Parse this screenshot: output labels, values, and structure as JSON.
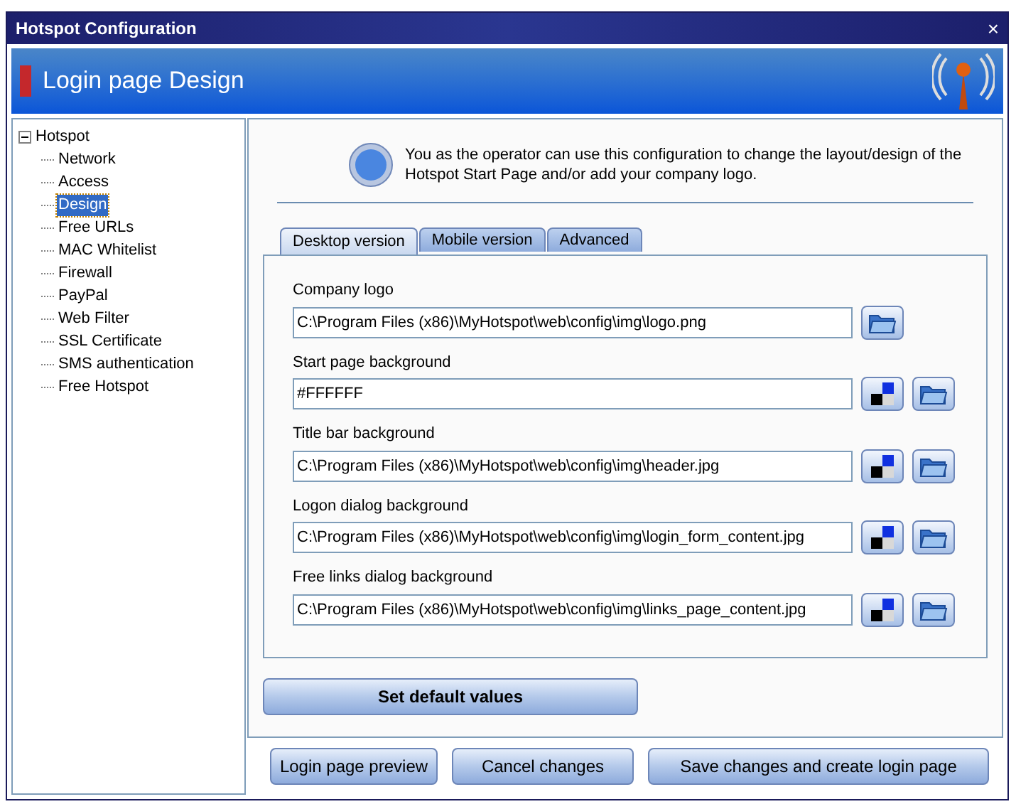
{
  "window": {
    "title": "Hotspot Configuration",
    "close": "×"
  },
  "header": {
    "title": "Login page Design"
  },
  "sidebar": {
    "tree": [
      {
        "label": "Hotspot",
        "expanded": true,
        "selected": false,
        "children": [
          {
            "label": "Network",
            "selected": false
          },
          {
            "label": "Access",
            "selected": false
          },
          {
            "label": "Design",
            "selected": true
          },
          {
            "label": "Free URLs",
            "selected": false
          },
          {
            "label": "MAC Whitelist",
            "selected": false
          },
          {
            "label": "Firewall",
            "selected": false
          },
          {
            "label": "PayPal",
            "selected": false
          },
          {
            "label": "Web Filter",
            "selected": false
          },
          {
            "label": "SSL Certificate",
            "selected": false
          },
          {
            "label": "SMS authentication",
            "selected": false
          },
          {
            "label": "Free Hotspot",
            "selected": false
          }
        ]
      }
    ]
  },
  "info": "You as the operator can use this configuration to change the layout/design of the Hotspot Start Page and/or add your company logo.",
  "tabs": [
    {
      "label": "Desktop version",
      "selected": true
    },
    {
      "label": "Mobile version",
      "selected": false
    },
    {
      "label": "Advanced",
      "selected": false
    }
  ],
  "fields": [
    {
      "label": "Company logo",
      "value": "C:\\Program Files (x86)\\MyHotspot\\web\\config\\img\\logo.png",
      "kind": "file"
    },
    {
      "label": "Start page background",
      "value": "#FFFFFF",
      "kind": "color"
    },
    {
      "label": "Title bar background",
      "value": "C:\\Program Files (x86)\\MyHotspot\\web\\config\\img\\header.jpg",
      "kind": "color"
    },
    {
      "label": "Logon dialog background",
      "value": "C:\\Program Files (x86)\\MyHotspot\\web\\config\\img\\login_form_content.jpg",
      "kind": "color"
    },
    {
      "label": "Free links dialog background",
      "value": "C:\\Program Files (x86)\\MyHotspot\\web\\config\\img\\links_page_content.jpg",
      "kind": "color"
    }
  ],
  "default_button": "Set default values",
  "footer_buttons": [
    "Login page preview",
    "Cancel changes",
    "Save changes and create login page"
  ]
}
